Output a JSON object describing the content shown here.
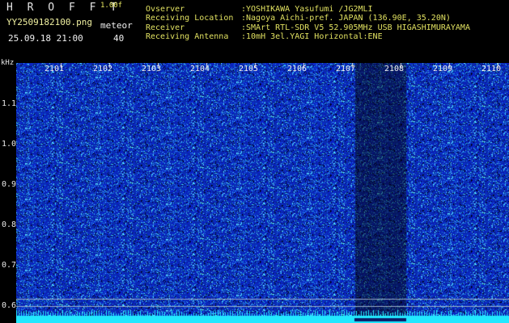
{
  "header": {
    "brand": "H R O F F T",
    "version": "1.00f",
    "filename": "YY2509182100.png",
    "datetime": "25.09.18 21:00",
    "meteor_label": "meteor",
    "meteor_count": "40"
  },
  "info": [
    {
      "key": "Ovserver",
      "value": ":YOSHIKAWA Yasufumi /JG2MLI"
    },
    {
      "key": "Receiving Location",
      "value": ":Nagoya Aichi-pref. JAPAN (136.90E, 35.20N)"
    },
    {
      "key": "Receiver",
      "value": ":SMArt RTL-SDR V5 52.905MHz USB HIGASHIMURAYAMA"
    },
    {
      "key": "Receiving Antenna",
      "value": ":10mH 3el.YAGI Horizontal:ENE"
    }
  ],
  "axis": {
    "y_unit": "kHz",
    "y_ticks": [
      "1.1",
      "1.0",
      "0.9",
      "0.8",
      "0.7",
      "0.6"
    ],
    "x_ticks": [
      "2101",
      "2102",
      "2103",
      "2104",
      "2105",
      "2106",
      "2107",
      "2108",
      "2109",
      "2110"
    ]
  },
  "colors": {
    "background": "#000000",
    "noise_base": "#1c2fc0",
    "baseline": "#22e8ff",
    "label_yellow": "#e0e060"
  }
}
